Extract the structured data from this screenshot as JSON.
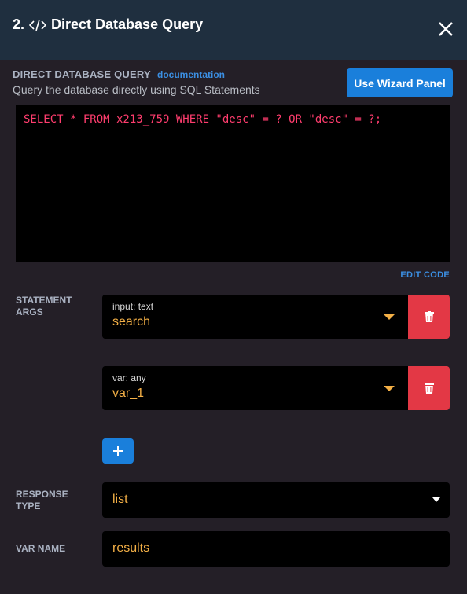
{
  "header": {
    "step_number": "2.",
    "title": "Direct Database Query"
  },
  "intro": {
    "section_label": "DIRECT DATABASE QUERY",
    "documentation_link": "documentation",
    "subtitle": "Query the database directly using SQL Statements",
    "wizard_button": "Use Wizard Panel"
  },
  "editor": {
    "code": "SELECT * FROM x213_759 WHERE \"desc\" = ? OR \"desc\" = ?;",
    "edit_code_link": "EDIT CODE"
  },
  "statement_args": {
    "label_line1": "STATEMENT",
    "label_line2": "ARGS",
    "items": [
      {
        "type": "input: text",
        "value": "search"
      },
      {
        "type": "var: any",
        "value": "var_1"
      }
    ]
  },
  "response_type": {
    "label_line1": "RESPONSE",
    "label_line2": "TYPE",
    "value": "list"
  },
  "var_name": {
    "label": "VAR NAME",
    "value": "results"
  },
  "colors": {
    "header_bg": "#1f2f3f",
    "body_bg": "#241f27",
    "accent_blue": "#1a7fdb",
    "danger_red": "#e33845",
    "value_orange": "#f4b046",
    "code_pink": "#ff3d6e"
  },
  "icons": {
    "code": "code-icon",
    "close": "close-icon",
    "delete": "trash-icon",
    "add": "plus-icon",
    "caret": "caret-down-icon"
  }
}
